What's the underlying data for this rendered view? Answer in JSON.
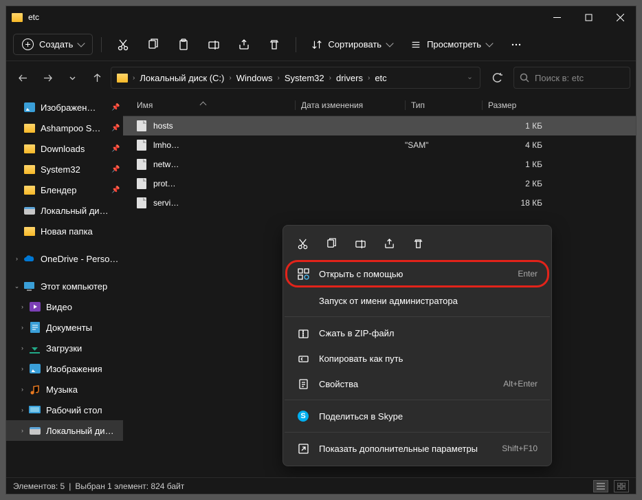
{
  "title": "etc",
  "toolbar": {
    "create": "Создать",
    "sort": "Сортировать",
    "view": "Просмотреть"
  },
  "breadcrumbs": [
    "Локальный диск (C:)",
    "Windows",
    "System32",
    "drivers",
    "etc"
  ],
  "search_placeholder": "Поиск в: etc",
  "columns": {
    "name": "Имя",
    "date": "Дата изменения",
    "type": "Тип",
    "size": "Размер"
  },
  "sidebar": [
    {
      "label": "Изображен…",
      "icon": "image",
      "pin": true
    },
    {
      "label": "Ashampoo S…",
      "icon": "folder",
      "pin": true
    },
    {
      "label": "Downloads",
      "icon": "folder",
      "pin": true
    },
    {
      "label": "System32",
      "icon": "folder",
      "pin": true
    },
    {
      "label": "Блендер",
      "icon": "folder",
      "pin": true
    },
    {
      "label": "Локальный ди…",
      "icon": "drive"
    },
    {
      "label": "Новая папка",
      "icon": "folder"
    },
    {
      "label": "",
      "spacer": true
    },
    {
      "label": "OneDrive - Perso…",
      "icon": "onedrive",
      "exp": ">"
    },
    {
      "label": "",
      "spacer": true
    },
    {
      "label": "Этот компьютер",
      "icon": "pc",
      "exp": "v"
    },
    {
      "label": "Видео",
      "icon": "video",
      "indent": true,
      "exp": ">"
    },
    {
      "label": "Документы",
      "icon": "docs",
      "indent": true,
      "exp": ">"
    },
    {
      "label": "Загрузки",
      "icon": "down",
      "indent": true,
      "exp": ">"
    },
    {
      "label": "Изображения",
      "icon": "image",
      "indent": true,
      "exp": ">"
    },
    {
      "label": "Музыка",
      "icon": "music",
      "indent": true,
      "exp": ">"
    },
    {
      "label": "Рабочий стол",
      "icon": "desk",
      "indent": true,
      "exp": ">"
    },
    {
      "label": "Локальный ди…",
      "icon": "drive",
      "indent": true,
      "exp": ">",
      "sel": true
    }
  ],
  "files": [
    {
      "name": "hosts",
      "date": "",
      "type": "",
      "size": "1 КБ",
      "sel": true
    },
    {
      "name": "lmho…",
      "date": "",
      "type": "\"SAM\"",
      "size": "4 КБ"
    },
    {
      "name": "netw…",
      "date": "",
      "type": "",
      "size": "1 КБ"
    },
    {
      "name": "prot…",
      "date": "",
      "type": "",
      "size": "2 КБ"
    },
    {
      "name": "servi…",
      "date": "",
      "type": "",
      "size": "18 КБ"
    }
  ],
  "context": {
    "open_with": "Открыть с помощью",
    "open_with_key": "Enter",
    "run_admin": "Запуск от имени администратора",
    "zip": "Сжать в ZIP-файл",
    "copy_path": "Копировать как путь",
    "props": "Свойства",
    "props_key": "Alt+Enter",
    "skype": "Поделиться в Skype",
    "more": "Показать дополнительные параметры",
    "more_key": "Shift+F10"
  },
  "status": {
    "count": "Элементов: 5",
    "sep": "|",
    "sel": "Выбран 1 элемент: 824 байт"
  }
}
